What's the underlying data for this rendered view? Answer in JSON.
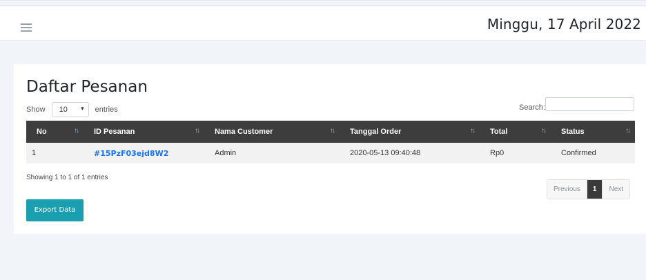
{
  "header": {
    "date": "Minggu, 17 April 2022"
  },
  "orders": {
    "title": "Daftar Pesanan",
    "show_label": "Show",
    "page_size": "10",
    "entries_label": "entries",
    "search_label": "Search:",
    "search_value": "",
    "columns": [
      "No",
      "ID Pesanan",
      "Nama Customer",
      "Tanggal Order",
      "Total",
      "Status"
    ],
    "rows": [
      {
        "no": "1",
        "id": "#15PzF03ejd8W2",
        "customer": "Admin",
        "date": "2020-05-13 09:40:48",
        "total": "Rp0",
        "status": "Confirmed"
      }
    ],
    "info": "Showing 1 to 1 of 1 entries",
    "pagination": {
      "previous": "Previous",
      "current": "1",
      "next": "Next"
    },
    "export_label": "Export Data"
  },
  "colors": {
    "accent": "#1a9fb0",
    "header_bg": "#3d3d3d",
    "link": "#1a73e8"
  },
  "icons": {
    "menu": "hamburger-icon",
    "sort": "sort-icon",
    "dropdown": "chevron-updown-icon"
  }
}
